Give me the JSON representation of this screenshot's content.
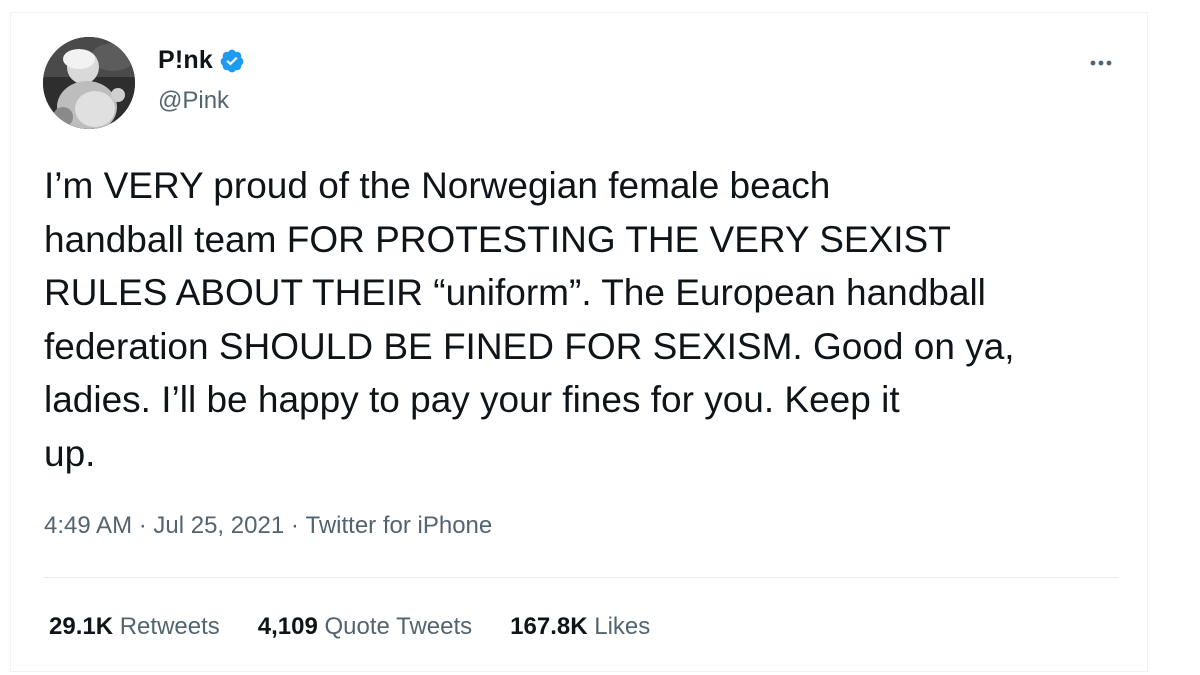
{
  "tweet": {
    "author": {
      "display_name": "P!nk",
      "handle": "@Pink",
      "verified": true,
      "avatar_icon": "profile-photo-icon"
    },
    "text": "I’m VERY proud of the Norwegian female beach\nhandball team FOR PROTESTING THE VERY SEXIST\nRULES ABOUT THEIR “uniform”. The European handball\nfederation SHOULD BE FINED FOR SEXISM. Good on ya,\nladies. I’ll be happy to pay your fines for you. Keep it\nup.",
    "meta": {
      "time": "4:49 AM",
      "separator": " · ",
      "date": "Jul 25, 2021",
      "source": "Twitter for iPhone"
    },
    "stats": {
      "retweets_count": "29.1K",
      "retweets_label": "Retweets",
      "quotes_count": "4,109",
      "quotes_label": "Quote Tweets",
      "likes_count": "167.8K",
      "likes_label": "Likes"
    }
  },
  "colors": {
    "text_primary": "#0f1419",
    "text_secondary": "#536471",
    "verified_blue": "#1d9bf0",
    "divider": "#e6ecf0"
  },
  "icons": {
    "verified": "verified-badge-icon",
    "more": "more-options-icon"
  }
}
